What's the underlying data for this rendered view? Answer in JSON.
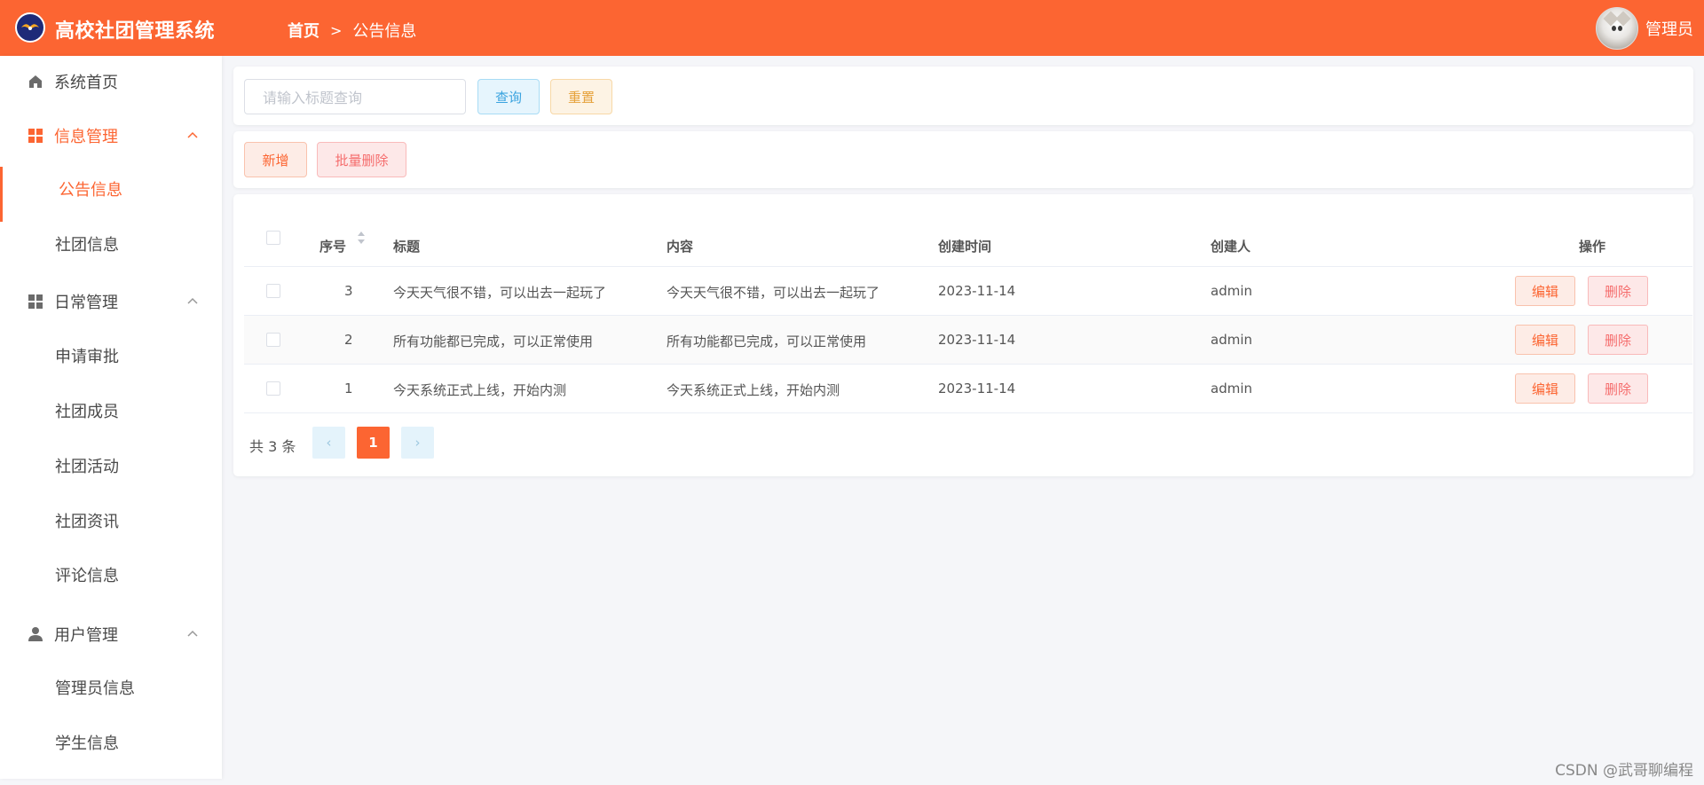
{
  "app": {
    "title": "高校社团管理系统"
  },
  "breadcrumb": {
    "home": "首页",
    "separator": ">",
    "current": "公告信息"
  },
  "user": {
    "name": "管理员"
  },
  "sidebar": {
    "home": "系统首页",
    "info_group": {
      "label": "信息管理",
      "items": [
        "公告信息",
        "社团信息"
      ]
    },
    "daily_group": {
      "label": "日常管理",
      "items": [
        "申请审批",
        "社团成员",
        "社团活动",
        "社团资讯",
        "评论信息"
      ]
    },
    "user_group": {
      "label": "用户管理",
      "items": [
        "管理员信息",
        "学生信息"
      ]
    }
  },
  "search": {
    "placeholder": "请输入标题查询",
    "query_label": "查询",
    "reset_label": "重置"
  },
  "toolbar": {
    "add_label": "新增",
    "batch_delete_label": "批量删除"
  },
  "table": {
    "columns": {
      "index": "序号",
      "title": "标题",
      "content": "内容",
      "created": "创建时间",
      "creator": "创建人",
      "actions": "操作"
    },
    "rows": [
      {
        "index": "3",
        "title": "今天天气很不错，可以出去一起玩了",
        "content": "今天天气很不错，可以出去一起玩了",
        "created": "2023-11-14",
        "creator": "admin"
      },
      {
        "index": "2",
        "title": "所有功能都已完成，可以正常使用",
        "content": "所有功能都已完成，可以正常使用",
        "created": "2023-11-14",
        "creator": "admin"
      },
      {
        "index": "1",
        "title": "今天系统正式上线，开始内测",
        "content": "今天系统正式上线，开始内测",
        "created": "2023-11-14",
        "creator": "admin"
      }
    ],
    "edit_label": "编辑",
    "delete_label": "删除"
  },
  "pagination": {
    "total_text": "共 3 条",
    "current_page": "1",
    "prev": "‹",
    "next": "›"
  },
  "watermark": "CSDN @武哥聊编程",
  "colors": {
    "accent": "#fc6532",
    "query": "#3aa3df",
    "reset": "#e6a23c",
    "danger": "#f56c6c"
  }
}
